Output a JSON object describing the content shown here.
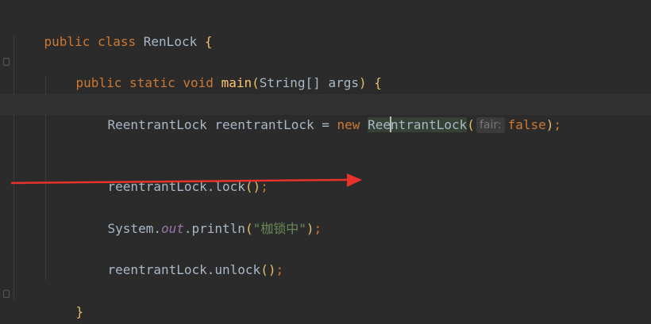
{
  "code": {
    "line1": {
      "kw_public": "public",
      "kw_class": "class",
      "class_name": "RenLock",
      "brace_open": "{"
    },
    "line2": {
      "kw_public": "public",
      "kw_static": "static",
      "kw_void": "void",
      "method_name": "main",
      "paren_open": "(",
      "param_type": "String[] args",
      "paren_close": ")",
      "brace_open": "{"
    },
    "line3": {
      "decl": "ReentrantLock reentrantLock = ",
      "kw_new": "new",
      "ctor_before_caret": "Ree",
      "ctor_after_caret": "ntrantLock",
      "paren_open": "(",
      "hint_label": "fair:",
      "arg_value": "false",
      "paren_close": ")",
      "semicolon": ";"
    },
    "line4": {
      "call": "reentrantLock.lock",
      "parens": "()",
      "semicolon": ";"
    },
    "line5": {
      "prefix": "System.",
      "field": "out",
      "method": ".println",
      "paren_open": "(",
      "string": "\"枷锁中\"",
      "paren_close": ")",
      "semicolon": ";"
    },
    "line6": {
      "call": "reentrantLock.unlock",
      "parens": "()",
      "semicolon": ";"
    },
    "line7": {
      "brace_close": "}"
    },
    "line8": {
      "brace_close": "}"
    }
  },
  "colors": {
    "background": "#2b2b2b",
    "keyword": "#cc7832",
    "method": "#ffc66d",
    "text": "#a9b7c6",
    "string": "#6a8759",
    "static_field": "#9876aa",
    "annotation_arrow": "#e8322b"
  },
  "annotation": {
    "icon": "red-arrow-icon"
  }
}
